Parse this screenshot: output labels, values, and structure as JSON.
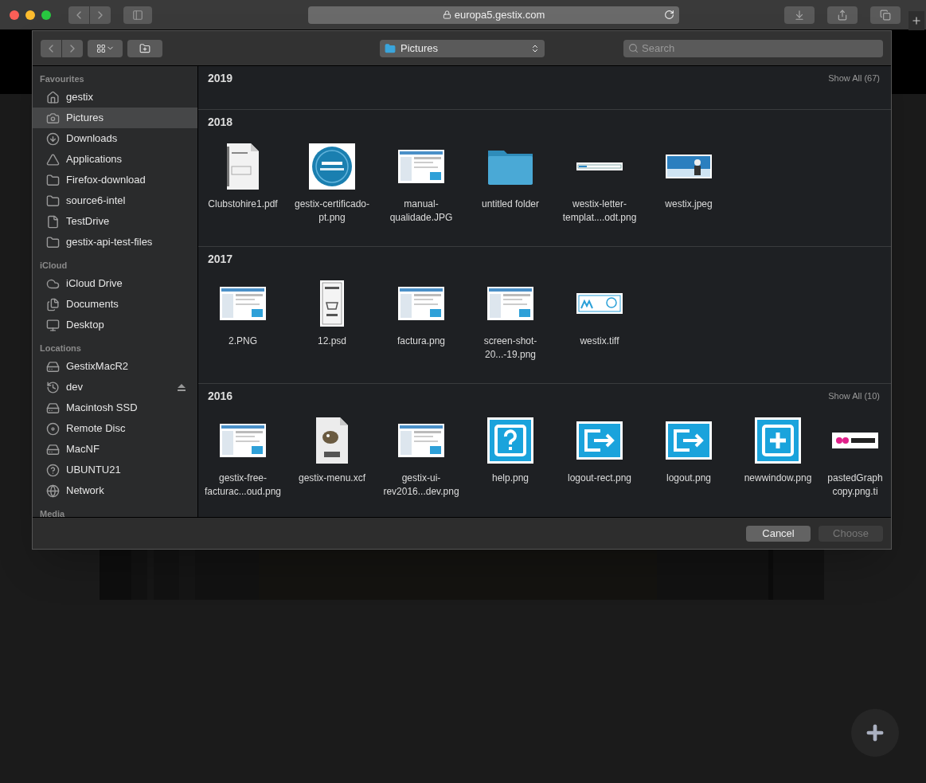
{
  "browser": {
    "url": "europa5.gestix.com"
  },
  "dialog": {
    "location": "Pictures",
    "search_placeholder": "Search",
    "sidebar": [
      {
        "heading": "Favourites",
        "items": [
          {
            "label": "gestix",
            "kind": "home",
            "selected": false
          },
          {
            "label": "Pictures",
            "kind": "camera",
            "selected": true
          },
          {
            "label": "Downloads",
            "kind": "download",
            "selected": false
          },
          {
            "label": "Applications",
            "kind": "apps",
            "selected": false
          },
          {
            "label": "Firefox-download",
            "kind": "folder",
            "selected": false
          },
          {
            "label": "source6-intel",
            "kind": "folder",
            "selected": false
          },
          {
            "label": "TestDrive",
            "kind": "file",
            "selected": false
          },
          {
            "label": "gestix-api-test-files",
            "kind": "folder",
            "selected": false
          }
        ]
      },
      {
        "heading": "iCloud",
        "items": [
          {
            "label": "iCloud Drive",
            "kind": "cloud",
            "selected": false
          },
          {
            "label": "Documents",
            "kind": "documents",
            "selected": false
          },
          {
            "label": "Desktop",
            "kind": "desktop",
            "selected": false
          }
        ]
      },
      {
        "heading": "Locations",
        "items": [
          {
            "label": "GestixMacR2",
            "kind": "drive",
            "selected": false
          },
          {
            "label": "dev",
            "kind": "timemachine",
            "selected": false,
            "ejectable": true
          },
          {
            "label": "Macintosh SSD",
            "kind": "disk",
            "selected": false
          },
          {
            "label": "Remote Disc",
            "kind": "disc",
            "selected": false
          },
          {
            "label": "MacNF",
            "kind": "drive",
            "selected": false
          },
          {
            "label": "UBUNTU21",
            "kind": "unknown",
            "selected": false
          },
          {
            "label": "Network",
            "kind": "network",
            "selected": false
          }
        ]
      },
      {
        "heading": "Media"
      }
    ],
    "sections": [
      {
        "year": "2019",
        "show_all": "Show All (67)"
      },
      {
        "year": "2018",
        "files": [
          {
            "name": "Clubstohire1.pdf",
            "kind": "pdf"
          },
          {
            "name": "gestix-certificado-pt.png",
            "kind": "badge"
          },
          {
            "name": "manual-qualidade.JPG",
            "kind": "screenshot"
          },
          {
            "name": "untitled folder",
            "kind": "folder"
          },
          {
            "name": "westix-letter-templat....odt.png",
            "kind": "strip"
          },
          {
            "name": "westix.jpeg"
          }
        ]
      },
      {
        "year": "2017",
        "files": [
          {
            "name": "2.PNG",
            "kind": "screenshot"
          },
          {
            "name": "12.psd",
            "kind": "receipt"
          },
          {
            "name": "factura.png",
            "kind": "screenshot"
          },
          {
            "name": "screen-shot-20...-19.png",
            "kind": "screenshot"
          },
          {
            "name": "westix.tiff",
            "kind": "logo"
          }
        ]
      },
      {
        "year": "2016",
        "show_all": "Show All (10)",
        "files": [
          {
            "name": "gestix-free-facturac...oud.png",
            "kind": "screenshot"
          },
          {
            "name": "gestix-menu.xcf",
            "kind": "xcf"
          },
          {
            "name": "gestix-ui-rev2016...dev.png",
            "kind": "screenshot"
          },
          {
            "name": "help.png",
            "kind": "help"
          },
          {
            "name": "logout-rect.png",
            "kind": "exit"
          },
          {
            "name": "logout.png",
            "kind": "exit"
          },
          {
            "name": "newwindow.png",
            "kind": "plus"
          },
          {
            "name": "pastedGraph copy.png.ti",
            "kind": "sticker"
          }
        ]
      }
    ],
    "buttons": [
      {
        "label": "Cancel",
        "disabled": false
      },
      {
        "label": "Choose",
        "disabled": true
      }
    ]
  }
}
